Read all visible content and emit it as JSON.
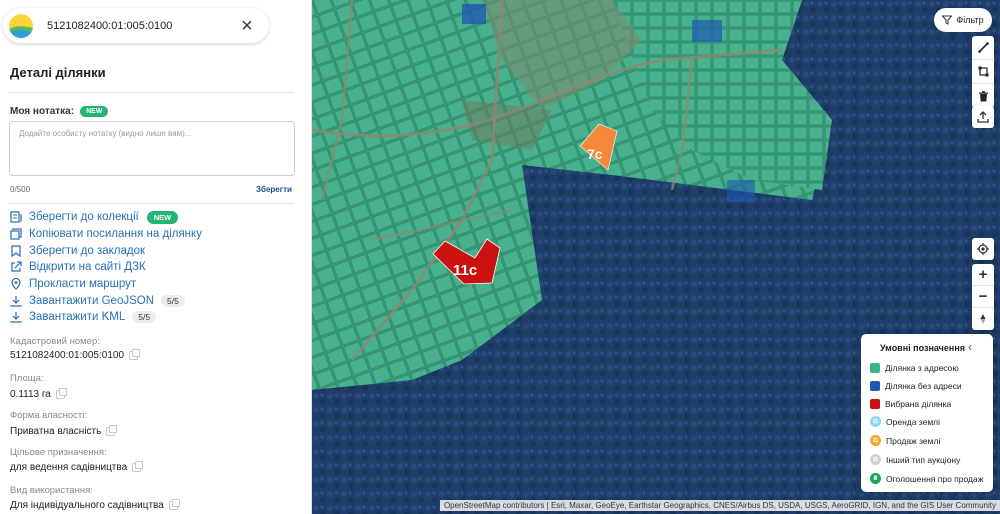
{
  "search": {
    "value": "5121082400:01:005:0100"
  },
  "details": {
    "title": "Деталі ділянки",
    "note_label": "Моя нотатка:",
    "note_badge": "NEW",
    "note_placeholder": "Додайте особисту нотатку (видно лише вам)...",
    "note_count": "0/500",
    "note_save": "Зберегти"
  },
  "actions": [
    {
      "label": "Зберегти до колекції",
      "icon": "folder-icon",
      "badge": "NEW"
    },
    {
      "label": "Копіювати посилання на ділянку",
      "icon": "copy-link-icon"
    },
    {
      "label": "Зберегти до закладок",
      "icon": "bookmark-icon"
    },
    {
      "label": "Відкрити на сайті ДЗК",
      "icon": "external-link-icon"
    },
    {
      "label": "Прокласти маршрут",
      "icon": "pin-icon"
    },
    {
      "label": "Завантажити GeoJSON",
      "icon": "download-icon",
      "count": "5/5"
    },
    {
      "label": "Завантажити KML",
      "icon": "download-icon",
      "count": "5/5"
    }
  ],
  "fields": [
    {
      "label": "Кадастровий номер:",
      "value": "5121082400:01:005:0100"
    },
    {
      "label": "Площа:",
      "value": "0.1113 га"
    },
    {
      "label": "Форма власності:",
      "value": "Приватна власність"
    },
    {
      "label": "Цільове призначення:",
      "value": "для ведення садівництва"
    },
    {
      "label": "Вид використання:",
      "value": "Для індивідуального садівництва"
    }
  ],
  "map": {
    "filter_label": "Фільтр",
    "parcels": {
      "selected": "11c",
      "sale": "7c"
    },
    "legend": {
      "title": "Умовні позначення",
      "items": [
        {
          "label": "Ділянка з адресою",
          "color": "#3fb28a",
          "kind": "swatch"
        },
        {
          "label": "Ділянка без адреси",
          "color": "#1f5ab0",
          "kind": "swatch"
        },
        {
          "label": "Вибрана ділянка",
          "color": "#cc1111",
          "kind": "swatch"
        },
        {
          "label": "Оренда землі",
          "color": "#8ed7ee",
          "kind": "dot"
        },
        {
          "label": "Продаж землі",
          "color": "#f5a623",
          "kind": "dot"
        },
        {
          "label": "Інший тип аукціону",
          "color": "#cfcfcf",
          "kind": "dot"
        },
        {
          "label": "Оголошення про продаж",
          "color": "#1aa35a",
          "kind": "dot"
        }
      ]
    },
    "zoom": {
      "in": "+",
      "out": "−"
    },
    "attribution": "OpenStreetMap contributors | Esri, Maxar, GeoEye, Earthstar Geographics, CNES/Airbus DS, USDA, USGS, AeroGRID, IGN, and the GIS User Community"
  },
  "colors": {
    "accent": "#2a6fb5",
    "new_badge": "#22b573",
    "parcel_green": "#3fb28a",
    "parcel_selected": "#cc1111",
    "parcel_sale": "#f5883a"
  }
}
